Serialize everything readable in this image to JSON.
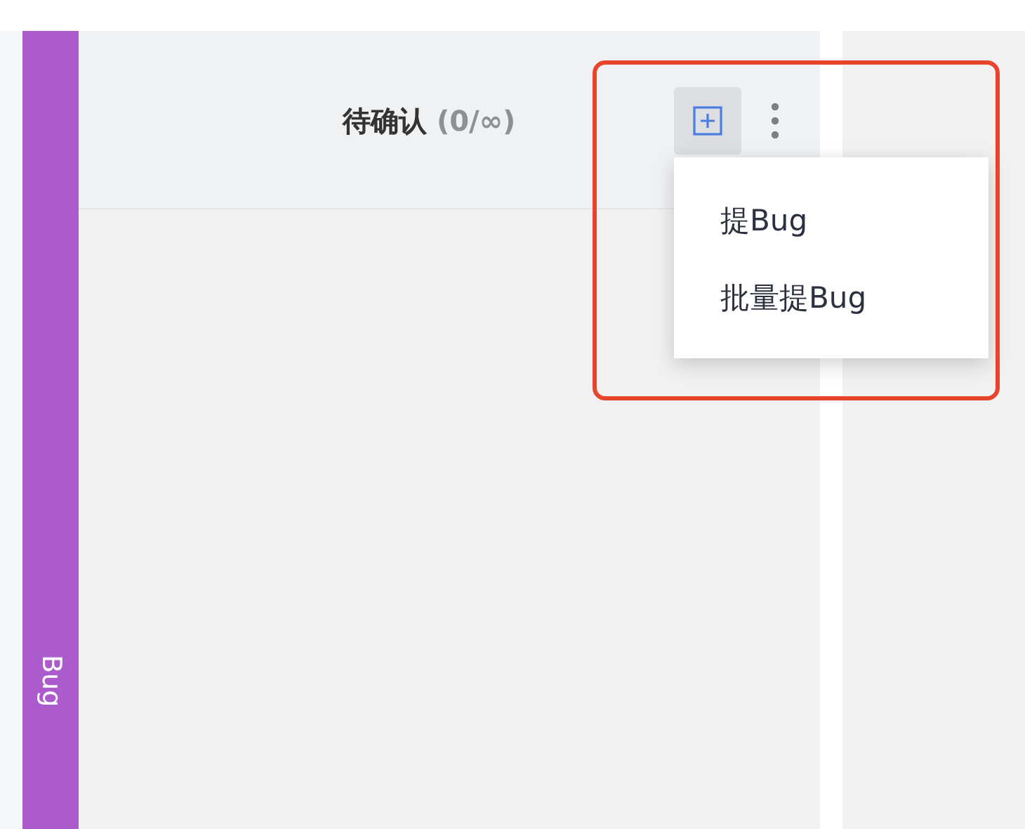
{
  "lane": {
    "label": "Bug",
    "color": "#ab5bcb"
  },
  "column": {
    "title": "待确认",
    "count": "(0/∞)"
  },
  "menu": {
    "open": true,
    "items": [
      {
        "label": "提Bug"
      },
      {
        "label": "批量提Bug"
      }
    ]
  }
}
